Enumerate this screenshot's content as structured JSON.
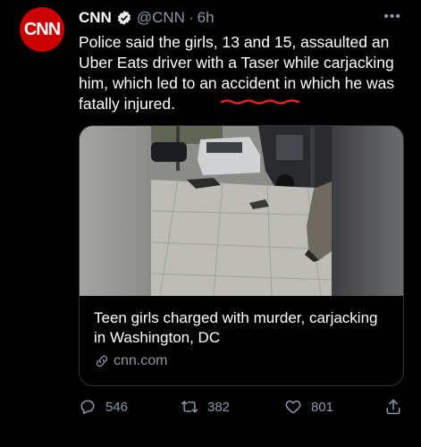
{
  "tweet": {
    "avatar_text": "CNN",
    "name": "CNN",
    "handle": "@CNN",
    "separator": "·",
    "time": "6h",
    "text": "Police said the girls, 13 and 15, assaulted an Uber Eats driver with a Taser while carjacking him, which led to an accident in which he was fatally injured.",
    "more_label": "•••"
  },
  "card": {
    "title": "Teen girls charged with murder, carjacking in Washington, DC",
    "domain": "cnn.com"
  },
  "actions": {
    "replies": "546",
    "retweets": "382",
    "likes": "801"
  },
  "colors": {
    "brand": "#cc0000",
    "verified": "#e7e9ea",
    "annotation": "#e0241b",
    "muted": "#8b98a5"
  },
  "icons": [
    "verified-badge-icon",
    "more-icon",
    "link-icon",
    "reply-icon",
    "retweet-icon",
    "like-icon",
    "share-icon"
  ]
}
